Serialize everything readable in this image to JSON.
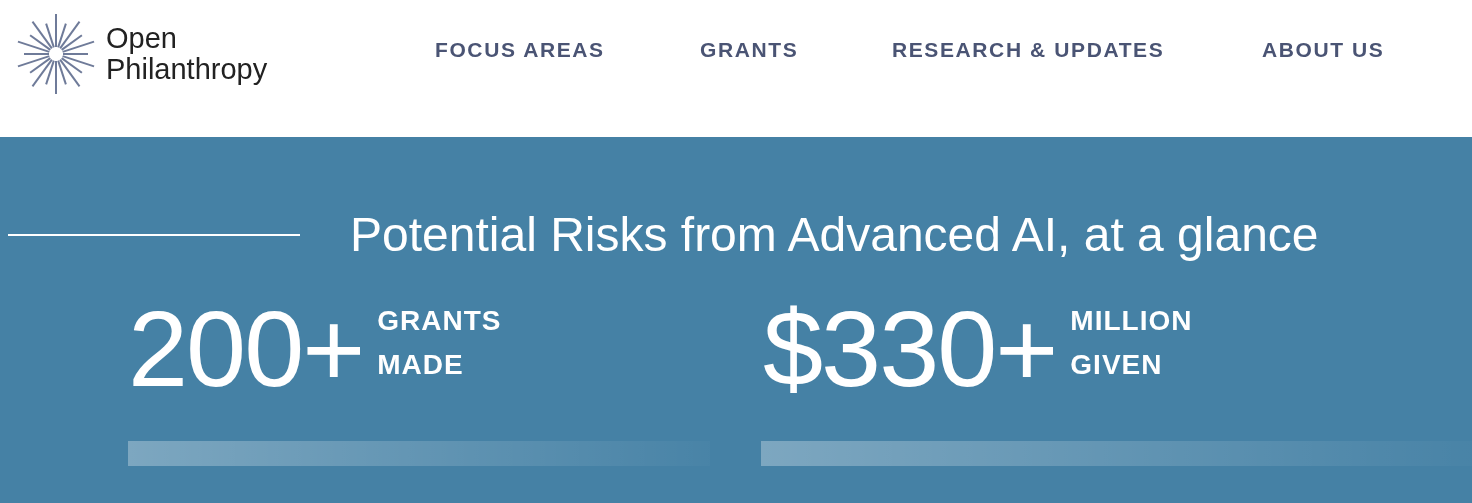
{
  "logo": {
    "line_1": "Open",
    "line_2": "Philanthropy"
  },
  "nav": [
    "FOCUS AREAS",
    "GRANTS",
    "RESEARCH & UPDATES",
    "ABOUT US"
  ],
  "hero": {
    "title": "Potential Risks from Advanced AI, at a glance",
    "stats": [
      {
        "value": "200+",
        "label_1": "GRANTS",
        "label_2": "MADE"
      },
      {
        "value": "$330+",
        "label_1": "MILLION",
        "label_2": "GIVEN"
      }
    ]
  }
}
